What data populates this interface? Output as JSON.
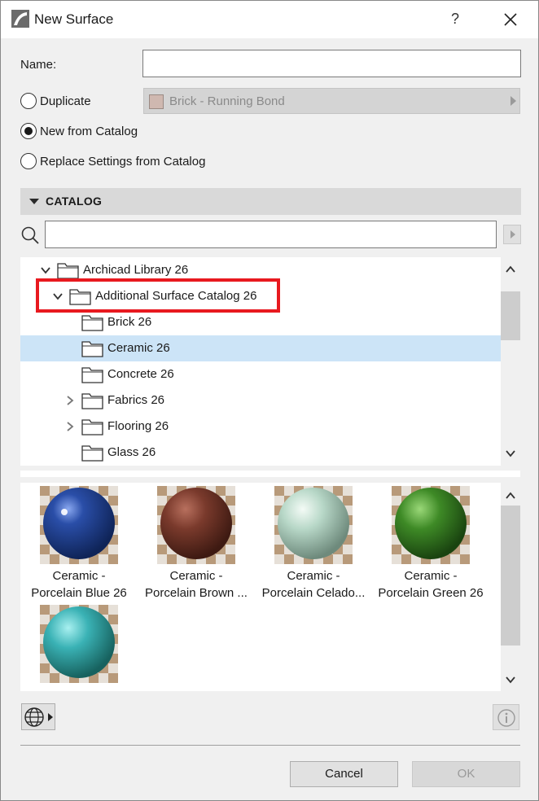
{
  "window": {
    "title": "New Surface",
    "help_label": "?"
  },
  "form": {
    "name_label": "Name:",
    "name_value": "",
    "options": [
      {
        "label": "Duplicate",
        "checked": false
      },
      {
        "label": "New from Catalog",
        "checked": true
      },
      {
        "label": "Replace Settings from Catalog",
        "checked": false
      }
    ],
    "duplicate_combo": {
      "value": "Brick - Running Bond",
      "swatch_color": "#cfb8b0"
    }
  },
  "catalog": {
    "header": "CATALOG",
    "search_value": "",
    "tree": [
      {
        "label": "Archicad Library 26",
        "level": 0,
        "expander": "expanded",
        "selected": false
      },
      {
        "label": "Additional Surface Catalog 26",
        "level": 1,
        "expander": "expanded",
        "selected": false
      },
      {
        "label": "Brick 26",
        "level": 2,
        "expander": "none",
        "selected": false
      },
      {
        "label": "Ceramic 26",
        "level": 2,
        "expander": "none",
        "selected": true
      },
      {
        "label": "Concrete 26",
        "level": 2,
        "expander": "none",
        "selected": false
      },
      {
        "label": "Fabrics 26",
        "level": 2,
        "expander": "collapsed",
        "selected": false
      },
      {
        "label": "Flooring 26",
        "level": 2,
        "expander": "collapsed",
        "selected": false
      },
      {
        "label": "Glass 26",
        "level": 2,
        "expander": "none",
        "selected": false
      }
    ],
    "thumbnails": [
      {
        "line1": "Ceramic -",
        "line2": "Porcelain Blue 26",
        "color": "#1f3f8f"
      },
      {
        "line1": "Ceramic -",
        "line2": "Porcelain Brown ...",
        "color": "#7a3a2c"
      },
      {
        "line1": "Ceramic -",
        "line2": "Porcelain Celado...",
        "color": "#b8d8c8"
      },
      {
        "line1": "Ceramic -",
        "line2": "Porcelain Green 26",
        "color": "#3e8a26"
      },
      {
        "line1": "",
        "line2": "",
        "color": "#3ab2b5"
      }
    ]
  },
  "footer": {
    "cancel_label": "Cancel",
    "ok_label": "OK"
  },
  "colors": {
    "selection": "#cce4f7",
    "highlight_border": "#e8191f"
  }
}
